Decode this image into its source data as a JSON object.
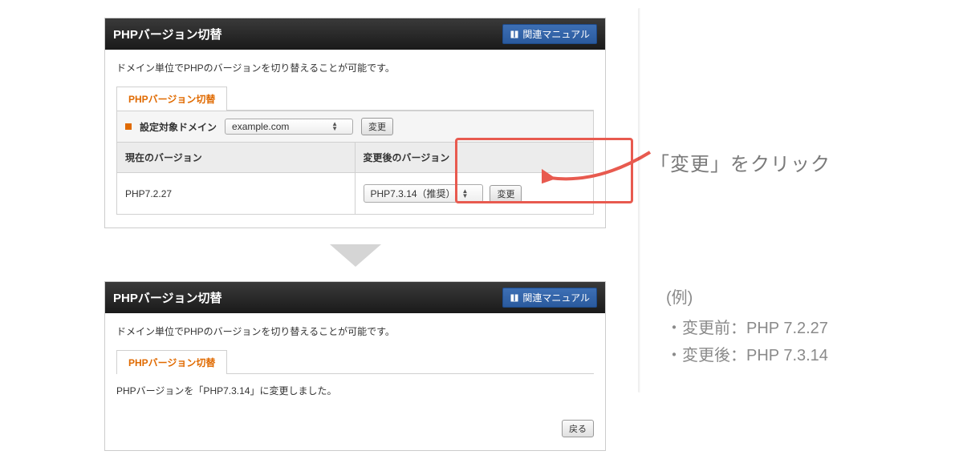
{
  "panel1": {
    "title": "PHPバージョン切替",
    "manual_btn": "関連マニュアル",
    "desc": "ドメイン単位でPHPのバージョンを切り替えることが可能です。",
    "tab": "PHPバージョン切替",
    "domain_label": "設定対象ドメイン",
    "domain_value": "example.com",
    "domain_change_btn": "変更",
    "col_current": "現在のバージョン",
    "col_after": "変更後のバージョン",
    "current_ver": "PHP7.2.27",
    "after_ver": "PHP7.3.14（推奨）",
    "change_btn": "変更"
  },
  "panel2": {
    "title": "PHPバージョン切替",
    "manual_btn": "関連マニュアル",
    "desc": "ドメイン単位でPHPのバージョンを切り替えることが可能です。",
    "tab": "PHPバージョン切替",
    "result_msg": "PHPバージョンを「PHP7.3.14」に変更しました。",
    "back_btn": "戻る"
  },
  "annotation": {
    "arrow_text": "「変更」をクリック"
  },
  "example": {
    "head": "(例)",
    "line1": "・変更前：PHP 7.2.27",
    "line2": "・変更後：PHP 7.3.14"
  },
  "colors": {
    "highlight": "#e85a4f",
    "accent": "#e06a00",
    "link_blue": "#2a5a9e"
  }
}
